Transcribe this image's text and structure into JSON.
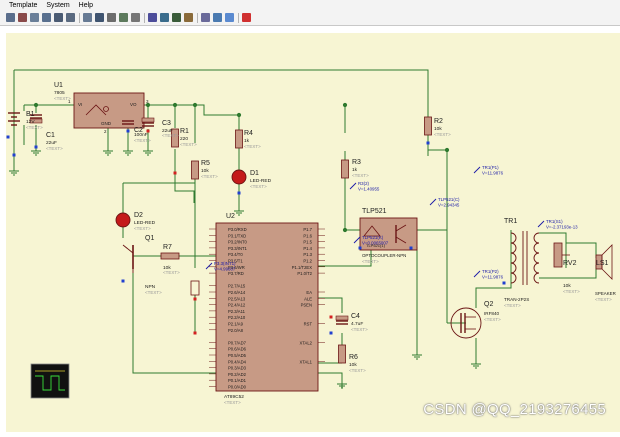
{
  "menu": {
    "items": [
      "Template",
      "System",
      "Help"
    ]
  },
  "toolbar": {
    "buttons": [
      "open-icon",
      "cut-icon",
      "copy-icon",
      "paste-icon",
      "block-copy-icon",
      "block-move-icon",
      "block-rotate-icon",
      "block-delete-icon",
      "zoom-icon",
      "wire-autorouter-icon",
      "search-icon",
      "property-assignment-icon",
      "design-explorer-icon",
      "new-sheet-icon",
      "remove-sheet-icon",
      "bill-of-materials-icon",
      "netlist-icon",
      "electrical-rules-icon",
      "pcb-layout-icon"
    ]
  },
  "schematic": {
    "components": {
      "B1": {
        "ref": "B1",
        "value": "12V"
      },
      "C1": {
        "ref": "C1",
        "value": "22uF"
      },
      "U1": {
        "ref": "U1",
        "value": "7805",
        "pin_vi": "VI",
        "pin_vo": "VO",
        "pin_gnd": "GND",
        "pin_in": "1",
        "pin_out": "3",
        "pin_g": "2"
      },
      "C2": {
        "ref": "C2",
        "value": "100nF"
      },
      "C3": {
        "ref": "C3",
        "value": "22uF"
      },
      "R1": {
        "ref": "R1",
        "value": "220"
      },
      "R4": {
        "ref": "R4",
        "value": "1k"
      },
      "R5": {
        "ref": "R5",
        "value": "10k"
      },
      "D1": {
        "ref": "D1",
        "value": "LED-RED"
      },
      "D2": {
        "ref": "D2",
        "value": "LED-RED"
      },
      "Q1": {
        "ref": "Q1",
        "value": "NPN"
      },
      "R7": {
        "ref": "R7",
        "value": "10k"
      },
      "U2": {
        "ref": "U2",
        "value": "AT89C52",
        "left_pins": [
          "P3.0/RXD",
          "P3.1/TXD",
          "P3.2/INT0",
          "P3.3/INT1",
          "P3.4/T0",
          "P3.5/T1",
          "P3.6/WR",
          "P3.7/RD",
          "",
          "P2.7/A15",
          "P2.6/A14",
          "P2.5/A13",
          "P2.4/A12",
          "P2.3/A11",
          "P2.2/A10",
          "P2.1/A9",
          "P2.0/A8",
          "",
          "P0.7/AD7",
          "P0.6/AD6",
          "P0.5/AD5",
          "P0.4/AD4",
          "P0.3/AD3",
          "P0.2/AD2",
          "P0.1/AD1",
          "P0.0/AD0"
        ],
        "right_pins": [
          "P1.7",
          "P1.6",
          "P1.5",
          "P1.4",
          "P1.3",
          "P1.2",
          "P1.1/T2EX",
          "P1.0/T2",
          "",
          "",
          "EA",
          "ALE",
          "PSEN",
          "",
          "",
          "RST",
          "",
          "",
          "XTAL2",
          "",
          "",
          "XTAL1"
        ]
      },
      "R3": {
        "ref": "R3",
        "value": "1k"
      },
      "R2": {
        "ref": "R2",
        "value": "10k"
      },
      "C4": {
        "ref": "C4",
        "value": "4.7uF"
      },
      "R6": {
        "ref": "R6",
        "value": "10k"
      },
      "TLP521": {
        "ref": "TLP521",
        "value": "OPTOCOUPLER-NPN",
        "sub": "TLP521(1)"
      },
      "TR1": {
        "ref": "TR1",
        "value": "TRAN-2P2S"
      },
      "RV2": {
        "ref": "RV2",
        "value": "10k"
      },
      "LS1": {
        "ref": "LS1",
        "value": "SPEAKER"
      },
      "Q2": {
        "ref": "Q2",
        "value": "IRF840"
      }
    },
    "text_placeholder": "<TEXT>",
    "probes": [
      {
        "name": "R3(2)",
        "reading": "V=1.40955"
      },
      {
        "name": "TLP521(C)",
        "reading": "V=2.94345"
      },
      {
        "name": "TLP521(K)",
        "reading": "V=0.0065007"
      },
      {
        "name": "TR1(P1)",
        "reading": "V=11.9876"
      },
      {
        "name": "TR1(P2)",
        "reading": "V=11.9876"
      },
      {
        "name": "TR1(S1)",
        "reading": "V=-2.37193e-13"
      },
      {
        "name": "P3.3(INT1)",
        "reading": "V=4.99807"
      }
    ]
  },
  "watermark": "CSDN @QQ_2193276455",
  "colors": {
    "sheet": "#f7f5d3",
    "wire": "#2f7a2f",
    "body": "#c79a85",
    "outline": "#6b1414",
    "label": "#1a1a1a",
    "placeholder": "#9a9a9a",
    "probe": "#1a1aa8",
    "pin_red": "#d42020",
    "pin_blue": "#2040d0"
  }
}
